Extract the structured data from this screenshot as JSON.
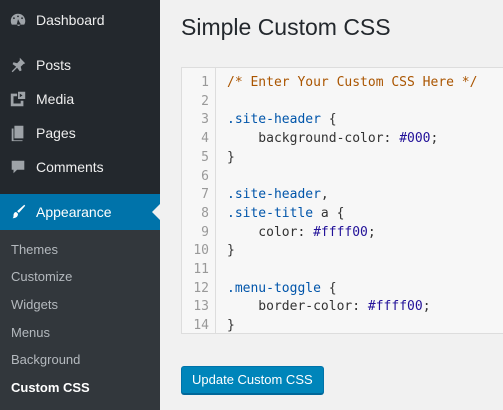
{
  "sidebar": {
    "items": [
      {
        "label": "Dashboard",
        "icon": "dashboard-icon"
      },
      {
        "label": "Posts",
        "icon": "pin-icon"
      },
      {
        "label": "Media",
        "icon": "media-icon"
      },
      {
        "label": "Pages",
        "icon": "pages-icon"
      },
      {
        "label": "Comments",
        "icon": "comment-icon"
      },
      {
        "label": "Appearance",
        "icon": "brush-icon",
        "current": true
      }
    ],
    "submenu": [
      {
        "label": "Themes"
      },
      {
        "label": "Customize"
      },
      {
        "label": "Widgets"
      },
      {
        "label": "Menus"
      },
      {
        "label": "Background"
      },
      {
        "label": "Custom CSS",
        "current": true
      }
    ]
  },
  "main": {
    "title": "Simple Custom CSS",
    "editor": {
      "line_numbers": [
        "1",
        "2",
        "3",
        "4",
        "5",
        "6",
        "7",
        "8",
        "9",
        "10",
        "11",
        "12",
        "13",
        "14"
      ],
      "lines": [
        [
          {
            "t": "/* Enter Your Custom CSS Here */",
            "c": "comment"
          }
        ],
        [],
        [
          {
            "t": ".site-header",
            "c": "sel"
          },
          {
            "t": " {",
            "c": "prop"
          }
        ],
        [
          {
            "t": "    background-color: ",
            "c": "prop"
          },
          {
            "t": "#000",
            "c": "val"
          },
          {
            "t": ";",
            "c": "prop"
          }
        ],
        [
          {
            "t": "}",
            "c": "prop"
          }
        ],
        [],
        [
          {
            "t": ".site-header",
            "c": "sel"
          },
          {
            "t": ",",
            "c": "prop"
          }
        ],
        [
          {
            "t": ".site-title",
            "c": "sel"
          },
          {
            "t": " a {",
            "c": "prop"
          }
        ],
        [
          {
            "t": "    color: ",
            "c": "prop"
          },
          {
            "t": "#ffff00",
            "c": "val"
          },
          {
            "t": ";",
            "c": "prop"
          }
        ],
        [
          {
            "t": "}",
            "c": "prop"
          }
        ],
        [],
        [
          {
            "t": ".menu-toggle",
            "c": "sel"
          },
          {
            "t": " {",
            "c": "prop"
          }
        ],
        [
          {
            "t": "    border-color: ",
            "c": "prop"
          },
          {
            "t": "#ffff00",
            "c": "val"
          },
          {
            "t": ";",
            "c": "prop"
          }
        ],
        [
          {
            "t": "}",
            "c": "prop"
          }
        ]
      ]
    },
    "update_button": "Update Custom CSS"
  },
  "colors": {
    "sidebar_bg": "#23282d",
    "submenu_bg": "#32373c",
    "accent": "#0073aa",
    "button": "#0085ba"
  }
}
